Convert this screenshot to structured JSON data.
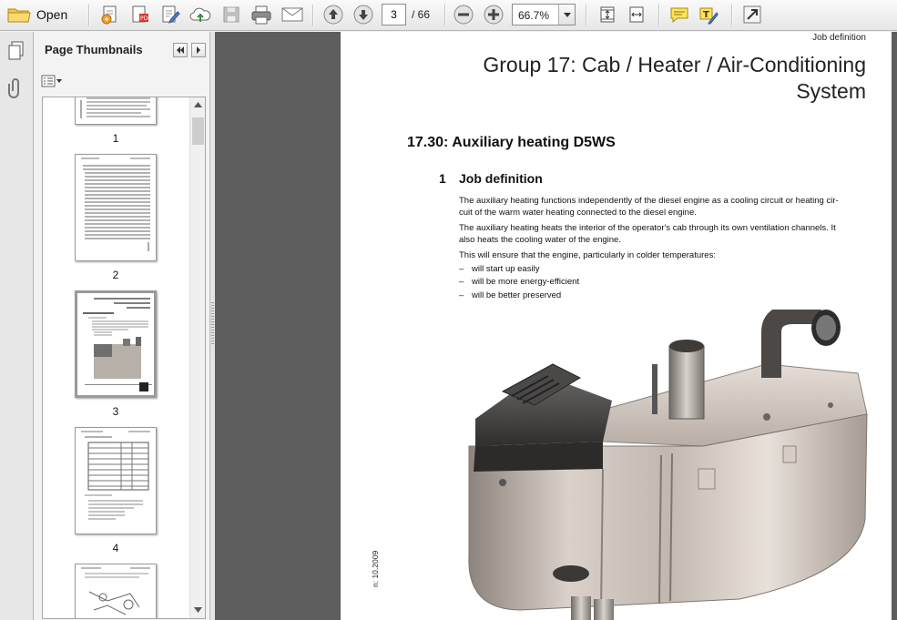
{
  "toolbar": {
    "open_label": "Open",
    "page_current": "3",
    "page_total": "/ 66",
    "zoom": "66.7%"
  },
  "panel": {
    "title": "Page Thumbnails",
    "thumbnails": [
      {
        "number": "1"
      },
      {
        "number": "2"
      },
      {
        "number": "3"
      },
      {
        "number": "4"
      }
    ]
  },
  "document": {
    "header": "Job definition",
    "group_title_line1": "Group 17: Cab / Heater /  Air-Conditioning",
    "group_title_line2": "System",
    "section_title": "17.30: Auxiliary heating D5WS",
    "sub_number": "1",
    "sub_title": "Job definition",
    "para1_line1": "The auxiliary heating functions independently of the diesel engine as a cooling circuit or heating cir-",
    "para1_line2": "cuit of the warm water heating connected to the diesel engine.",
    "para2_line1": "The auxiliary heating heats the interior of the operator's cab through its own ventilation channels. It",
    "para2_line2": "also heats the cooling water of the engine.",
    "para3": "This will ensure that the engine, particularly in colder temperatures:",
    "bullets": [
      "will start up easily",
      "will be more energy-efficient",
      "will be better preserved"
    ],
    "bullet_dash": "–",
    "side_note": "n: 10.2009"
  }
}
